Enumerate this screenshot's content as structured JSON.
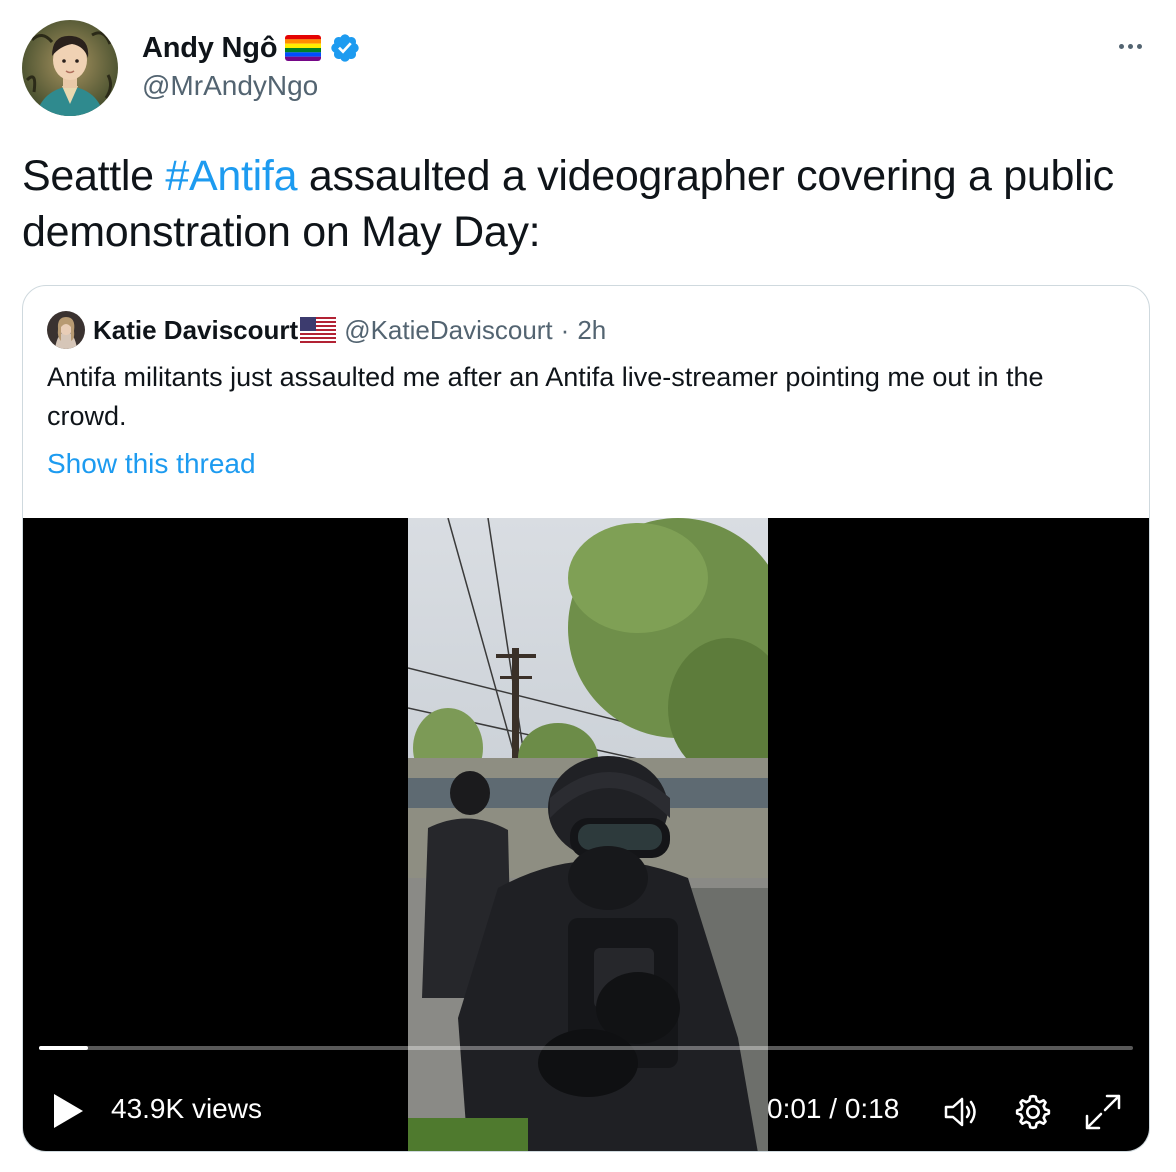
{
  "author": {
    "display_name": "Andy Ngô",
    "handle": "@MrAndyNgo",
    "verified": true
  },
  "tweet": {
    "text_before": "Seattle ",
    "hashtag": "#Antifa",
    "text_after": " assaulted a videographer covering a public demonstration on May Day:"
  },
  "quoted_tweet": {
    "display_name": "Katie Daviscourt",
    "handle": "@KatieDaviscourt",
    "separator": "·",
    "time": "2h",
    "text": "Antifa militants just assaulted me after an Antifa live-streamer pointing me out in the crowd.",
    "show_thread_label": "Show this thread"
  },
  "video": {
    "views_label": "43.9K views",
    "time_readout": "0:01 / 0:18",
    "progress_fraction": 0.045
  },
  "colors": {
    "accent": "#1d9bf0",
    "text": "#0f1419",
    "secondary_text": "#536471",
    "border": "#cfd9de"
  },
  "icons": {
    "more": "more-horizontal-icon",
    "verified": "verified-badge-icon",
    "play": "play-icon",
    "volume": "volume-icon",
    "settings": "settings-gear-icon",
    "fullscreen": "fullscreen-expand-icon"
  }
}
